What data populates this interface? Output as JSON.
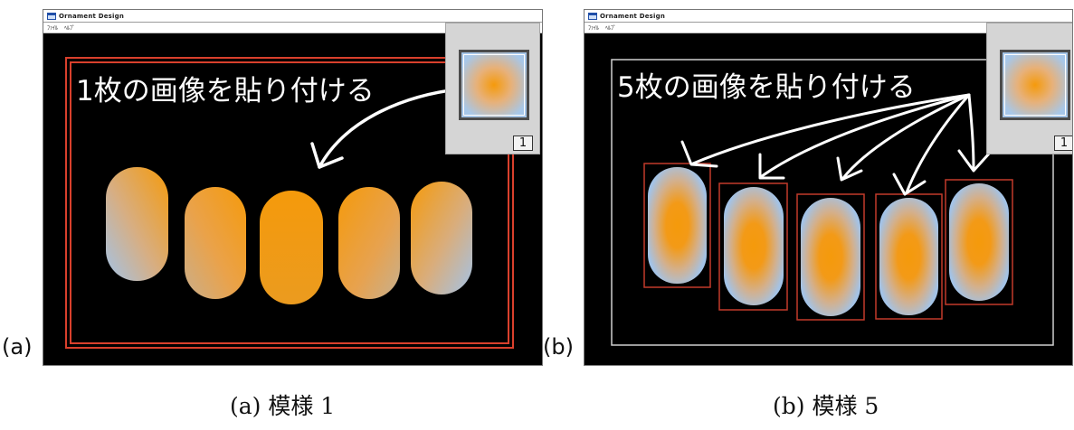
{
  "panels": [
    {
      "label": "(a)",
      "window_title": "Ornament Design",
      "menu": [
        "ﾌｧｲﾙ",
        "ﾍﾙﾌﾟ"
      ],
      "canvas_text": "1枚の画像を貼り付ける",
      "page_number": "1",
      "caption": "(a) 模様 1"
    },
    {
      "label": "(b)",
      "window_title": "Ornament Design",
      "menu": [
        "ﾌｧｲﾙ",
        "ﾍﾙﾌﾟ"
      ],
      "canvas_text": "5枚の画像を貼り付ける",
      "page_number": "1",
      "caption": "(b) 模様 5"
    }
  ],
  "colors": {
    "orange": "#f59a0b",
    "blue": "#a3c3e7",
    "frame_red": "#d9402c"
  }
}
